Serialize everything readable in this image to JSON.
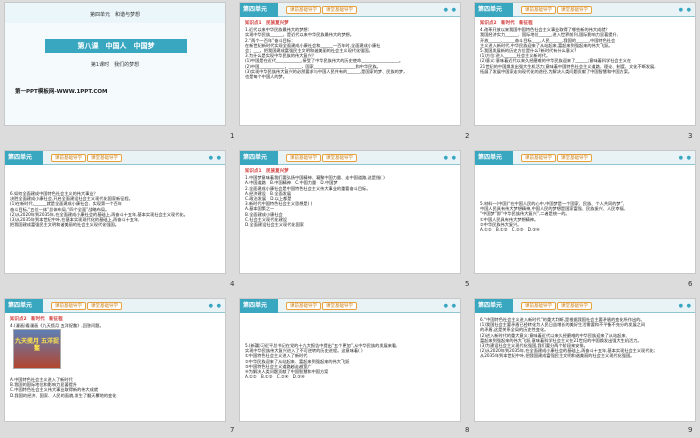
{
  "slides": [
    {
      "num": "1",
      "unit": "第四单元　和谐与梦想",
      "title": "第八课　中国人　中国梦",
      "subtitle": "第1课时　我们的梦想",
      "site": "第一PPT模板网-WWW.1PPT.COM"
    },
    {
      "num": "2",
      "badge": "第四单元",
      "tag1": "课前基础导学",
      "tag2": "课堂基础导学",
      "heading": "知识点1　民族复兴梦",
      "lines": [
        "1.近代以来中华民族最伟大的梦想：",
        "实现中华民族______，是近代以来中华民族最伟大的梦想。",
        "2.“两个一百年”奋斗目标：",
        "在新世纪新时代实现全面建成小康社会和______一百年时,全面建成小康社",
        "会；___，把我国建成富强民主文明和谐美丽的社会主义现代化强国。",
        "3.为什么是实现中华民族的伟大复兴？",
        "(1)中国是在近代____________,接受了中华民族伟大的历史使命__________________。",
        "(2)中国____________，______，国家____________________和中华民族。",
        "(3)实现中华民族伟大复兴的必然要求与中国人民共有的______,是国家的梦、民族的梦，",
        "也是每个中国人的梦。"
      ]
    },
    {
      "num": "3",
      "badge": "第四单元",
      "tag1": "课前基础导学",
      "tag2": "课堂基础导学",
      "heading": "知识点2　新时代　新征程",
      "lines": [
        "4.改革开放以来我国中国特色社会主义事业取得了哪些新的伟大成就？",
        "我国经济实力______、国际地位______,进入世界前列,国际影响力显著提升,",
        "开放______,______奋斗目标____,人民______,我国的______,中国特色社会",
        "主义进入新时代,中华民族迎来了从站起来,富起来到强起来的伟大飞跃。",
        "5.我国发展新的历史方位是什么?新时代有什么意义?",
        "(1)方位:进入______社会主义新时代。",
        "(2)意义:意味着近代以来久经磨难的中华民族迎来了______;意味着科学社会主义在",
        "21世纪的中国焕发出强大生机活力;意味着中国特色社会主义道路、理论、制度、文化不断发展,",
        "拓展了发展中国家走向现代化的途径,为解决人类问题贡献了中国智慧和中国方案。"
      ]
    },
    {
      "num": "4",
      "badge": "第四单元",
      "tag1": "课前基础导学",
      "tag2": "课堂基础导学",
      "heading": "",
      "lines": [
        "6.如何全面建成中国特色社会主义的伟大事业？",
        "决胜全面建成小康社会,开启全面建设社会主义现代化国家新征程。",
        "(1)在新时代,______就是全面建成小康社会、实现第一个百年",
        "奋斗目标,“五位一体”总体布局,“四个全面”战略布局。",
        "(2)从2020年到2035年,在全面建成小康社会的基础上,再奋斗十五年,基本实现社会主义现代化。",
        "(3)从2035年到本世纪中叶,在基本实现现代化的基础上,再奋斗十五年,",
        "把我国建成富强民主文明和谐美丽的社会主义现代化强国。"
      ]
    },
    {
      "num": "5",
      "badge": "第四单元",
      "tag1": "课前基础导学",
      "tag2": "课堂基础导学",
      "heading": "知识点1　民族复兴梦",
      "lines": [
        "1.中国梦意味着我们要弘扬中国精神、凝聚中国力量、走中国道路,这是指( )",
        "A.中国道路　B.中国精神　C.中国力量　D.中国梦",
        "2.全面建成小康社会是中国特色社会主义伟大事业的重要奋斗目标。",
        "A.经济建设　B.全面发展",
        "C.政治发展　D.以上都是",
        "3.新时代中国特色社会主义思想是( )",
        "A.基本国策之一",
        "B.全面建成小康社会",
        "C.社会主义现代化建设",
        "D.全面建设社会主义现代化国家"
      ]
    },
    {
      "num": "6",
      "badge": "第四单元",
      "tag1": "课前基础导学",
      "tag2": "课堂基础导学",
      "heading": "",
      "lines": [
        "5.材料一(中国)“在中国人民的心中,中国梦是一个国家、民族、个人共同的梦”,",
        "中国人民具有伟大梦想精神,中国人民的梦想是国家富强、民族振兴、人民幸福,",
        "“中国梦”即“中华民族伟大复兴”,二者是统一的。",
        "①中国人民具有伟大梦想精神。",
        "②中华民族伟大复兴。",
        "A.①②　B.①③　C.②③　D.③④"
      ]
    },
    {
      "num": "7",
      "badge": "第四单元",
      "tag1": "课前基础导学",
      "tag2": "课堂基础导学",
      "heading": "知识点2　新时代　新征程",
      "lines": [
        "4.(漫画)看漫画《九天揽月 五洋捉鳖》,回答问题。",
        "A.中国特色社会主义进入了新时代",
        "B.我国的国际地位和影响力显著提升",
        "C.中国特色社会主义伟大事业取得新的伟大成就",
        "D.我国的经济、国家、人民的面貌,发生了翻天覆地的变化"
      ]
    },
    {
      "num": "8",
      "badge": "第四单元",
      "tag1": "课前基础导学",
      "tag2": "课堂基础导学",
      "heading": "",
      "lines": [
        "5.(新疆)习近平总书记在党的十九大报告中提出“五个更加”,从中华民族的发展来看,",
        "实现中华民族伟大复兴进入了不可逆转的历史进程。这意味着( )",
        "①中国特色社会主义进入了新时代",
        "②中华民族迎来了从站起来、富起来到强起来的伟大飞跃",
        "③中国特色社会主义道路越走越宽广",
        "④为解决人类问题贡献了中国智慧和中国方案",
        "A.①②　B.①③　C.②④　D.③④"
      ]
    },
    {
      "num": "9",
      "badge": "第四单元",
      "tag1": "课前基础导学",
      "tag2": "课堂基础导学",
      "heading": "",
      "lines": [
        "6.“中国特色社会主义进入新时代”的重大判断,是根据我国社会主要矛盾的变化所作出的。",
        "(1)我国社会主要矛盾已经转化为人民日益增长的美好生活需要和不平衡不充分的发展之间",
        "的矛盾,这是关系全局的历史性变化。",
        "(2)进入新时代的重大意义:意味着近代以来久经磨难的中华民族迎来了从站起来、",
        "富起来到强起来的伟大飞跃,意味着科学社会主义在21世纪的中国焕发出强大生机活力。",
        "(3)为建设社会主义现代化强国,我们要分两个阶段来安排。",
        "(2)从2020年到2035年,在全面建成小康社会的基础上,再奋斗十五年,基本实现社会主义现代化;",
        "从2035年到本世纪中叶,把我国建成富强民主文明和谐美丽的社会主义现代化强国。"
      ]
    }
  ],
  "comic_text": "九天揽月 五洋捉鳖"
}
